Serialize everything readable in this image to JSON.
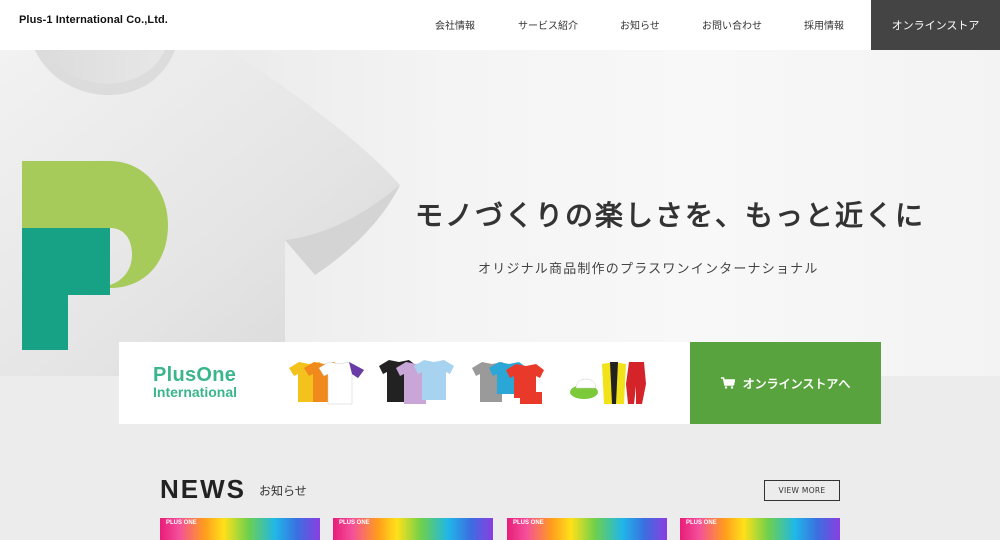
{
  "header": {
    "company_name": "Plus-1 International Co.,Ltd.",
    "nav": [
      {
        "label": "会社情報"
      },
      {
        "label": "サービス紹介"
      },
      {
        "label": "お知らせ"
      },
      {
        "label": "お問い合わせ"
      },
      {
        "label": "採用情報"
      }
    ],
    "store_label": "オンラインストア"
  },
  "hero": {
    "title": "モノづくりの楽しさを、もっと近くに",
    "subtitle": "オリジナル商品制作のプラスワンインターナショナル"
  },
  "banner": {
    "brand_line1": "PlusOne",
    "brand_line2": "International",
    "button_label": "オンラインストアへ"
  },
  "news": {
    "title": "NEWS",
    "subtitle": "お知らせ",
    "view_more": "VIEW MORE",
    "cards": [
      {
        "label": "PLUS ONE"
      },
      {
        "label": "PLUS ONE"
      },
      {
        "label": "PLUS ONE"
      },
      {
        "label": "PLUS ONE"
      }
    ]
  },
  "colors": {
    "store_bg": "#444444",
    "banner_button": "#59a33f",
    "brand_green": "#3bb58c",
    "logo_light_green": "#a6cb5a",
    "logo_dark_green": "#17a286"
  }
}
